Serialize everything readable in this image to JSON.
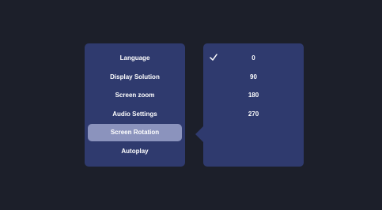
{
  "menu": {
    "items": [
      {
        "label": "Language"
      },
      {
        "label": "Display Solution"
      },
      {
        "label": "Screen zoom"
      },
      {
        "label": "Audio Settings"
      },
      {
        "label": "Screen Rotation"
      },
      {
        "label": "Autoplay"
      }
    ],
    "selected": "Screen Rotation"
  },
  "rotation_options": {
    "items": [
      {
        "label": "0"
      },
      {
        "label": "90"
      },
      {
        "label": "180"
      },
      {
        "label": "270"
      }
    ],
    "checked": "0"
  },
  "colors": {
    "background": "#1c1f2a",
    "panel": "#2f3a6e",
    "selected_highlight": "#8b93bd",
    "text": "#ffffff"
  },
  "icons": {
    "checked_indicator": "check-icon"
  }
}
